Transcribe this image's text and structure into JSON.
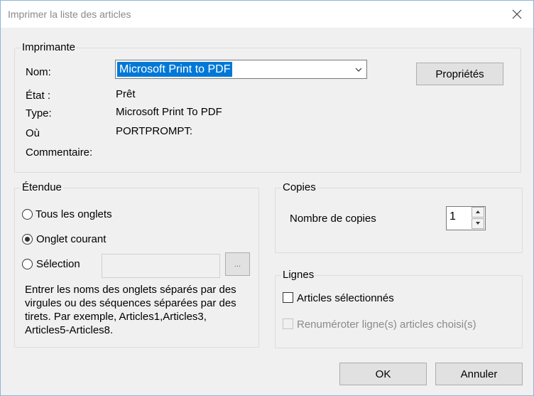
{
  "window": {
    "title": "Imprimer la liste des articles"
  },
  "printer": {
    "legend": "Imprimante",
    "name_label": "Nom:",
    "name_value": "Microsoft Print to PDF",
    "state_label": "État :",
    "state_value": "Prêt",
    "type_label": "Type:",
    "type_value": "Microsoft Print To PDF",
    "where_label": "Où",
    "where_value": "PORTPROMPT:",
    "comment_label": "Commentaire:",
    "properties_button": "Propriétés"
  },
  "range": {
    "legend": "Étendue",
    "all_tabs": "Tous les onglets",
    "current_tab": "Onglet courant",
    "selection": "Sélection",
    "selected": "current_tab",
    "browse_button": "...",
    "selection_value": "",
    "help": "Entrer les noms des onglets séparés par des virgules ou des séquences séparées par des tirets. Par exemple, Articles1,Articles3, Articles5-Articles8."
  },
  "copies": {
    "legend": "Copies",
    "count_label": "Nombre de copies",
    "count_value": "1"
  },
  "lines": {
    "legend": "Lignes",
    "selected_articles": "Articles sélectionnés",
    "selected_articles_checked": false,
    "renumber": "Renuméroter ligne(s) articles choisi(s)",
    "renumber_enabled": false
  },
  "buttons": {
    "ok": "OK",
    "cancel": "Annuler"
  }
}
